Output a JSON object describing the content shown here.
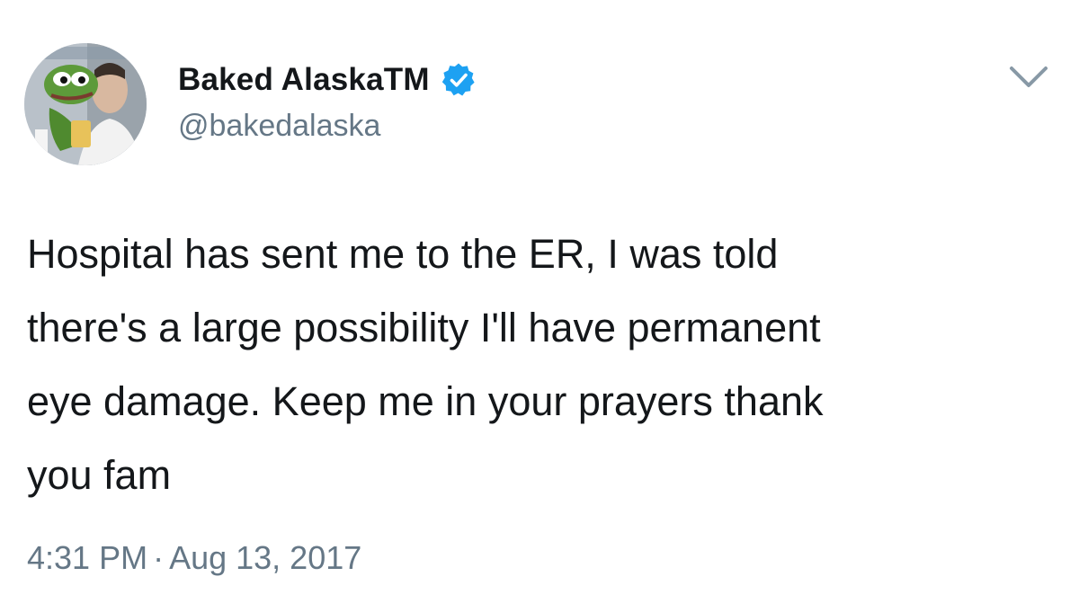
{
  "tweet": {
    "author": {
      "display_name": "Baked AlaskaTM",
      "handle": "@bakedalaska",
      "verified": true,
      "avatar": "avatar-image"
    },
    "menu_icon": "chevron-down-icon",
    "text": "Hospital has sent me to the ER, I was told\nthere's a large possibility I'll have permanent\neye damage. Keep me in your prayers thank\nyou fam",
    "time": "4:31 PM",
    "separator": "·",
    "date": "Aug 13, 2017"
  },
  "colors": {
    "primary_text": "#14171a",
    "secondary_text": "#657786",
    "verified_badge": "#1da1f2",
    "background": "#ffffff"
  }
}
